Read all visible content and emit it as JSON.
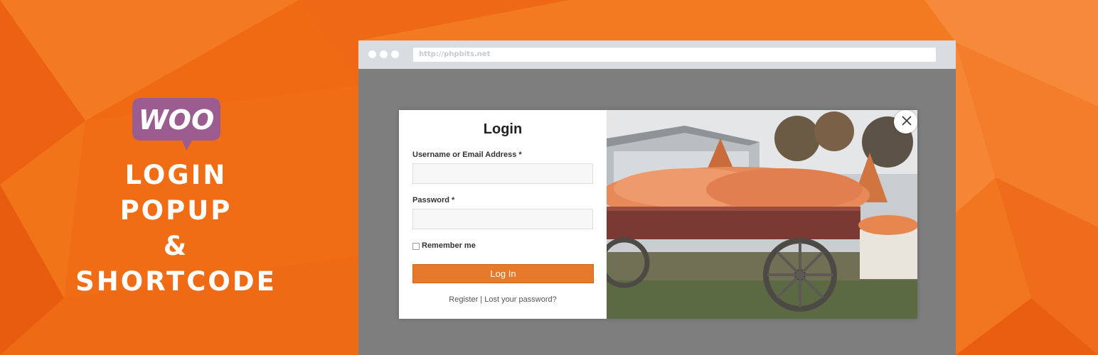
{
  "brand": {
    "logo_text": "WOO",
    "headline": [
      "LOGIN POPUP",
      "&",
      "SHORTCODE"
    ]
  },
  "browser": {
    "url": "http://phpbits.net"
  },
  "login": {
    "title": "Login",
    "username_label": "Username or Email Address *",
    "password_label": "Password *",
    "remember_label": "Remember me",
    "button_label": "Log In",
    "register_link": "Register",
    "separator": "|",
    "lost_password_link": "Lost your password?"
  },
  "icons": {
    "close": "close-icon",
    "logo": "woo-logo-icon"
  },
  "colors": {
    "background": "#f06a14",
    "woo_purple": "#9b5c8f",
    "button": "#e67a2a",
    "overlay": "#7e7e7e"
  }
}
